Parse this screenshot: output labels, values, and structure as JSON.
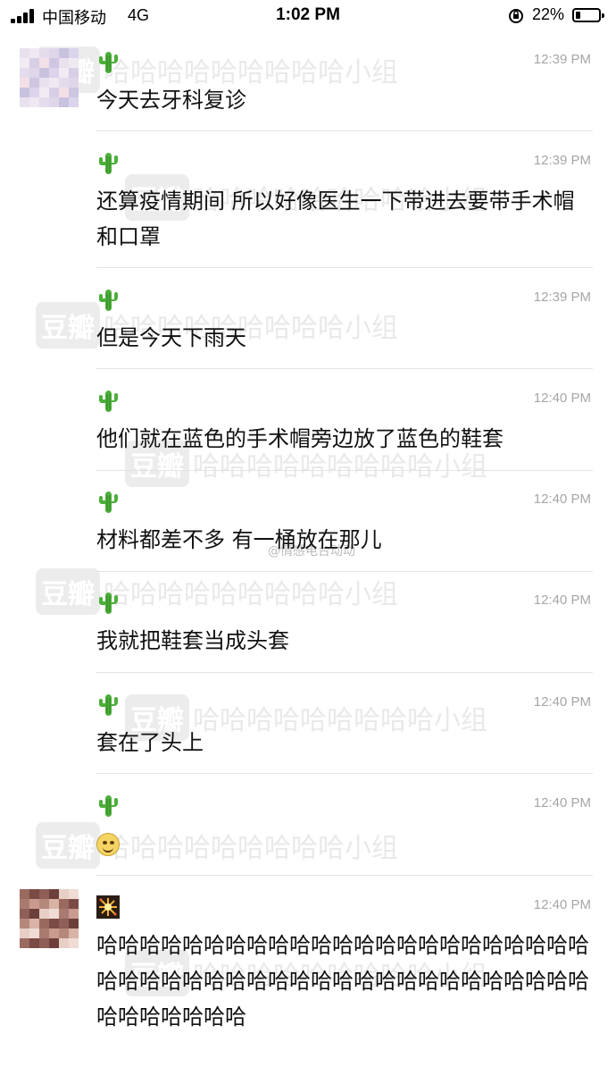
{
  "status_bar": {
    "carrier": "中国移动",
    "network": "4G",
    "time": "1:02 PM",
    "battery_percent": "22%",
    "battery_level": 0.22
  },
  "watermarks": {
    "badge": "豆瓣",
    "group_name": "哈哈哈哈哈哈哈哈哈小组",
    "weibo_handle": "@情感电台动动"
  },
  "messages": [
    {
      "time": "12:39 PM",
      "text": "今天去牙科复诊",
      "icon": "cactus-icon"
    },
    {
      "time": "12:39 PM",
      "text": "还算疫情期间 所以好像医生一下带进去要带手术帽和口罩",
      "icon": "cactus-icon"
    },
    {
      "time": "12:39 PM",
      "text": "但是今天下雨天",
      "icon": "cactus-icon"
    },
    {
      "time": "12:40 PM",
      "text": "他们就在蓝色的手术帽旁边放了蓝色的鞋套",
      "icon": "cactus-icon"
    },
    {
      "time": "12:40 PM",
      "text": "材料都差不多 有一桶放在那儿",
      "icon": "cactus-icon"
    },
    {
      "time": "12:40 PM",
      "text": "我就把鞋套当成头套",
      "icon": "cactus-icon"
    },
    {
      "time": "12:40 PM",
      "text": "套在了头上",
      "icon": "cactus-icon"
    },
    {
      "time": "12:40 PM",
      "text": "",
      "icon": "cactus-icon",
      "emoji": "smiling-face-emoji"
    },
    {
      "time": "12:40 PM",
      "text": "哈哈哈哈哈哈哈哈哈哈哈哈哈哈哈哈哈哈哈哈哈哈哈哈哈哈哈哈哈哈哈哈哈哈哈哈哈哈哈哈哈哈哈哈哈哈哈哈哈哈哈哈哈",
      "icon": "firework-icon"
    }
  ],
  "colors": {
    "timestamp": "#a6a6a6",
    "divider": "#e3e3e3",
    "cactus": "#4caf3a",
    "watermark": "#e9e9e9"
  }
}
